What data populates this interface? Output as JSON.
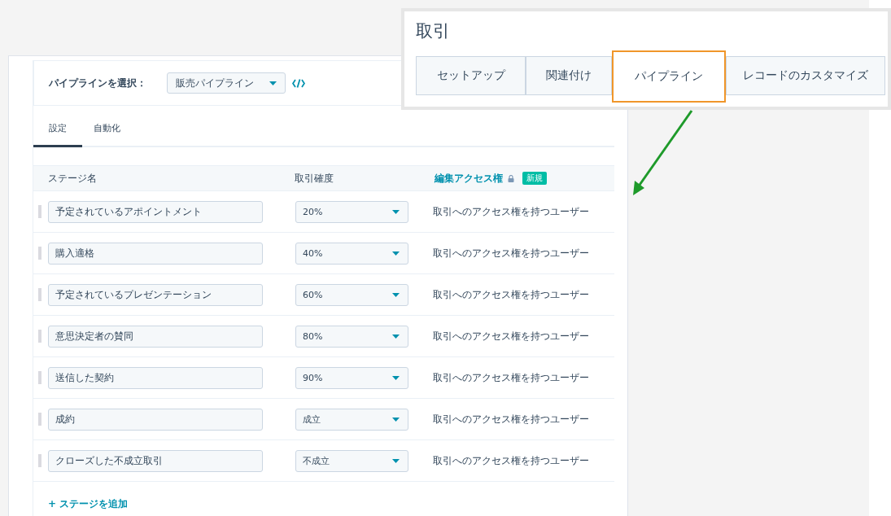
{
  "pipeline_select": {
    "label": "パイプラインを選択：",
    "value": "販売パイプライン"
  },
  "settings_tabs": [
    {
      "label": "設定",
      "selected": true
    },
    {
      "label": "自動化",
      "selected": false
    }
  ],
  "table": {
    "columns": [
      "ステージ名",
      "取引確度",
      "編集アクセス権"
    ],
    "badge": "新規",
    "rows": [
      {
        "name": "予定されているアポイントメント",
        "probability": "20%",
        "access": "取引へのアクセス権を持つユーザー"
      },
      {
        "name": "購入適格",
        "probability": "40%",
        "access": "取引へのアクセス権を持つユーザー"
      },
      {
        "name": "予定されているプレゼンテーション",
        "probability": "60%",
        "access": "取引へのアクセス権を持つユーザー"
      },
      {
        "name": "意思決定者の賛同",
        "probability": "80%",
        "access": "取引へのアクセス権を持つユーザー"
      },
      {
        "name": "送信した契約",
        "probability": "90%",
        "access": "取引へのアクセス権を持つユーザー"
      },
      {
        "name": "成約",
        "probability": "成立",
        "access": "取引へのアクセス権を持つユーザー"
      },
      {
        "name": "クローズした不成立取引",
        "probability": "不成立",
        "access": "取引へのアクセス権を持つユーザー"
      }
    ]
  },
  "add_stage": "+ ステージを追加",
  "overlay": {
    "title": "取引",
    "tabs": [
      {
        "label": "セットアップ",
        "selected": false
      },
      {
        "label": "関連付け",
        "selected": false
      },
      {
        "label": "パイプライン",
        "selected": true
      },
      {
        "label": "レコードのカスタマイズ",
        "selected": false
      }
    ]
  }
}
